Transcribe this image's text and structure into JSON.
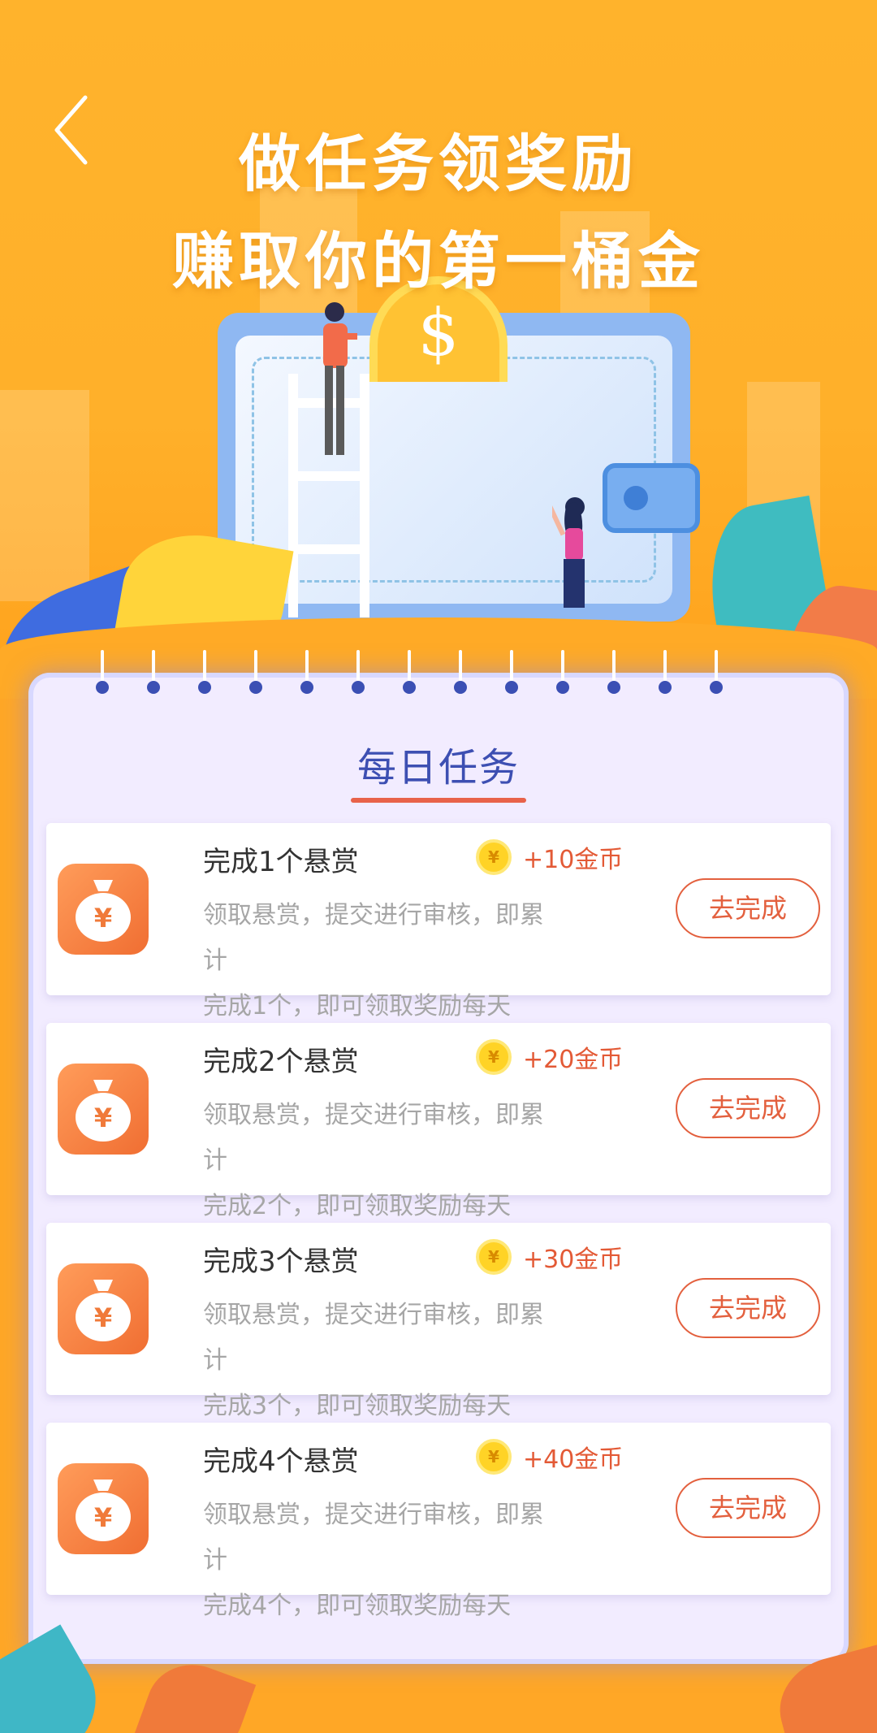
{
  "header": {
    "headline_line1": "做任务领奖励",
    "headline_line2": "赚取你的第一桶金"
  },
  "colors": {
    "background": "#ffa726",
    "card": "#f2ecff",
    "title": "#3d4fb2",
    "accent": "#e3603e",
    "desc": "#a6a6a6"
  },
  "section": {
    "title": "每日任务"
  },
  "tasks": [
    {
      "name": "完成1个悬赏",
      "reward": "+10金币",
      "desc_line1": "领取悬赏，提交进行审核，即累计",
      "desc_line2": "完成1个，即可领取奖励每天",
      "button": "去完成"
    },
    {
      "name": "完成2个悬赏",
      "reward": "+20金币",
      "desc_line1": "领取悬赏，提交进行审核，即累计",
      "desc_line2": "完成2个，即可领取奖励每天",
      "button": "去完成"
    },
    {
      "name": "完成3个悬赏",
      "reward": "+30金币",
      "desc_line1": "领取悬赏，提交进行审核，即累计",
      "desc_line2": "完成3个，即可领取奖励每天",
      "button": "去完成"
    },
    {
      "name": "完成4个悬赏",
      "reward": "+40金币",
      "desc_line1": "领取悬赏，提交进行审核，即累计",
      "desc_line2": "完成4个，即可领取奖励每天",
      "button": "去完成"
    }
  ],
  "icons": {
    "back": "chevron-left-icon",
    "task": "money-bag-icon",
    "coin": "coin-icon"
  }
}
